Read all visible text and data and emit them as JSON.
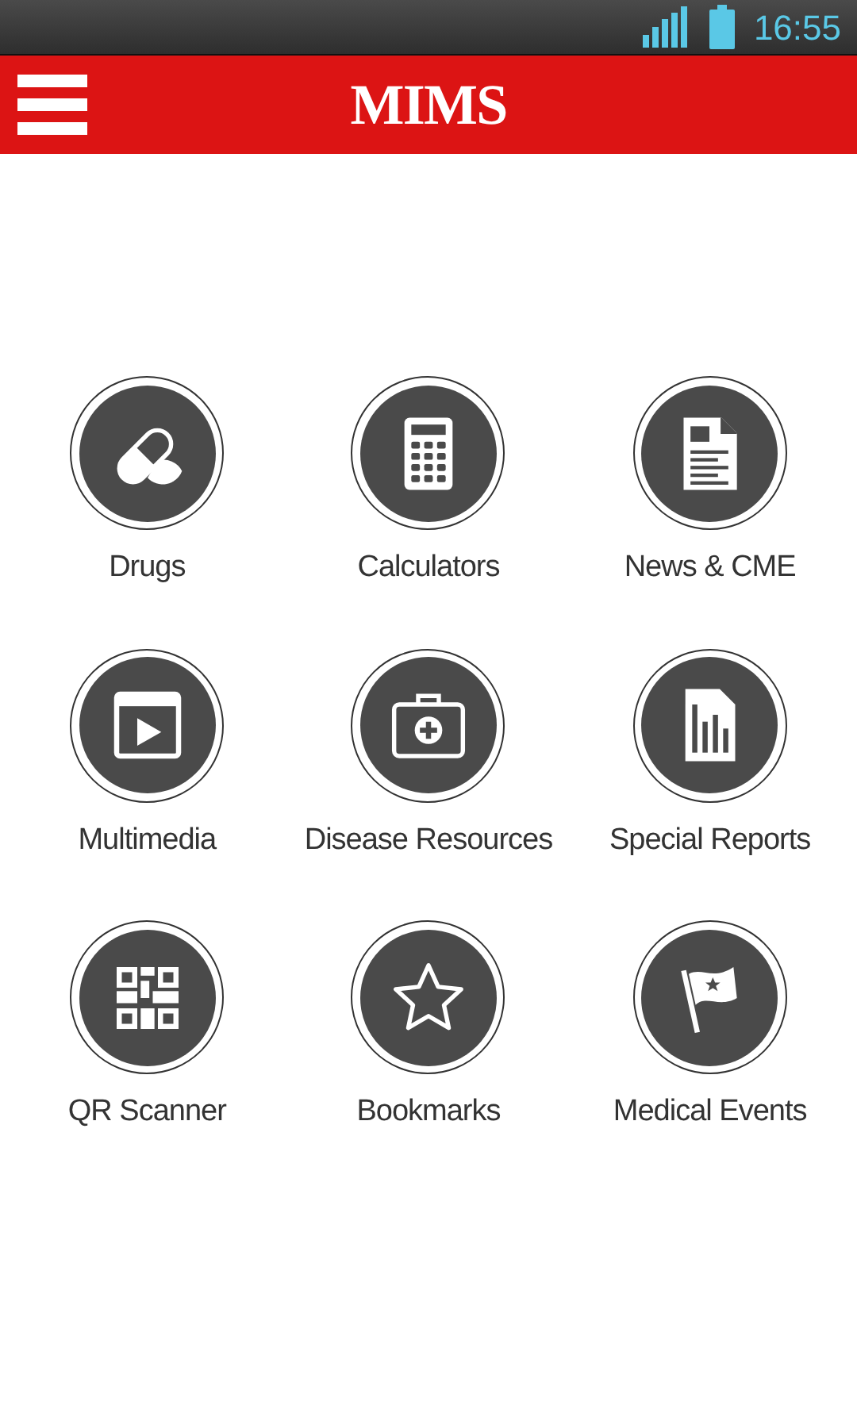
{
  "status_bar": {
    "time": "16:55"
  },
  "header": {
    "title": "MIMS"
  },
  "menu": [
    {
      "label": "Drugs",
      "kind": "pill"
    },
    {
      "label": "Calculators",
      "kind": "calculator"
    },
    {
      "label": "News & CME",
      "kind": "document"
    },
    {
      "label": "Multimedia",
      "kind": "video"
    },
    {
      "label": "Disease Resources",
      "kind": "medkit"
    },
    {
      "label": "Special Reports",
      "kind": "report"
    },
    {
      "label": "QR Scanner",
      "kind": "qr"
    },
    {
      "label": "Bookmarks",
      "kind": "star"
    },
    {
      "label": "Medical Events",
      "kind": "flag"
    }
  ]
}
